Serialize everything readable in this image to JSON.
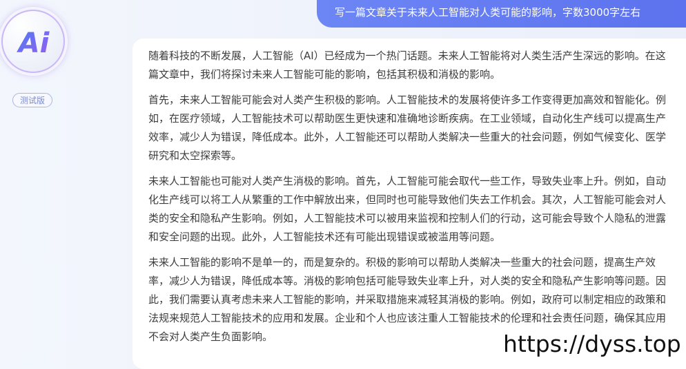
{
  "sidebar": {
    "avatar_text": "Ai",
    "version_badge": "测试版"
  },
  "chat": {
    "user_message": "写一篇文章关于未来人工智能对人类可能的影响，字数3000字左右",
    "answer_paragraphs": [
      "随着科技的不断发展，人工智能（AI）已经成为一个热门话题。未来人工智能将对人类生活产生深远的影响。在这篇文章中，我们将探讨未来人工智能可能的影响，包括其积极和消极的影响。",
      "首先，未来人工智能可能会对人类产生积极的影响。人工智能技术的发展将使许多工作变得更加高效和智能化。例如，在医疗领域，人工智能技术可以帮助医生更快速和准确地诊断疾病。在工业领域，自动化生产线可以提高生产效率，减少人为错误，降低成本。此外，人工智能还可以帮助人类解决一些重大的社会问题，例如气候变化、医学研究和太空探索等。",
      "未来人工智能也可能对人类产生消极的影响。首先，人工智能可能会取代一些工作，导致失业率上升。例如，自动化生产线可以将工人从繁重的工作中解放出来，但同时也可能导致他们失去工作机会。其次，人工智能可能会对人类的安全和隐私产生影响。例如，人工智能技术可以被用来监视和控制人们的行动，这可能会导致个人隐私的泄露和安全问题的出现。此外，人工智能技术还有可能出现错误或被滥用等问题。",
      "未来人工智能的影响不是单一的，而是复杂的。积极的影响可以帮助人类解决一些重大的社会问题，提高生产效率，减少人为错误，降低成本等。消极的影响包括可能导致失业率上升，对人类的安全和隐私产生影响等问题。因此，我们需要认真考虑未来人工智能的影响，并采取措施来减轻其消极的影响。例如，政府可以制定相应的政策和法规来规范人工智能技术的应用和发展。企业和个人也应该注重人工智能技术的伦理和社会责任问题，确保其应用不会对人类产生负面影响。"
    ]
  },
  "watermark": "https://dyss.top",
  "colors": {
    "user_bubble": "#6178f0",
    "badge_border": "#a9b7e4",
    "logo_gradient_start": "#4b7cf3",
    "logo_gradient_end": "#9b5cf0"
  }
}
